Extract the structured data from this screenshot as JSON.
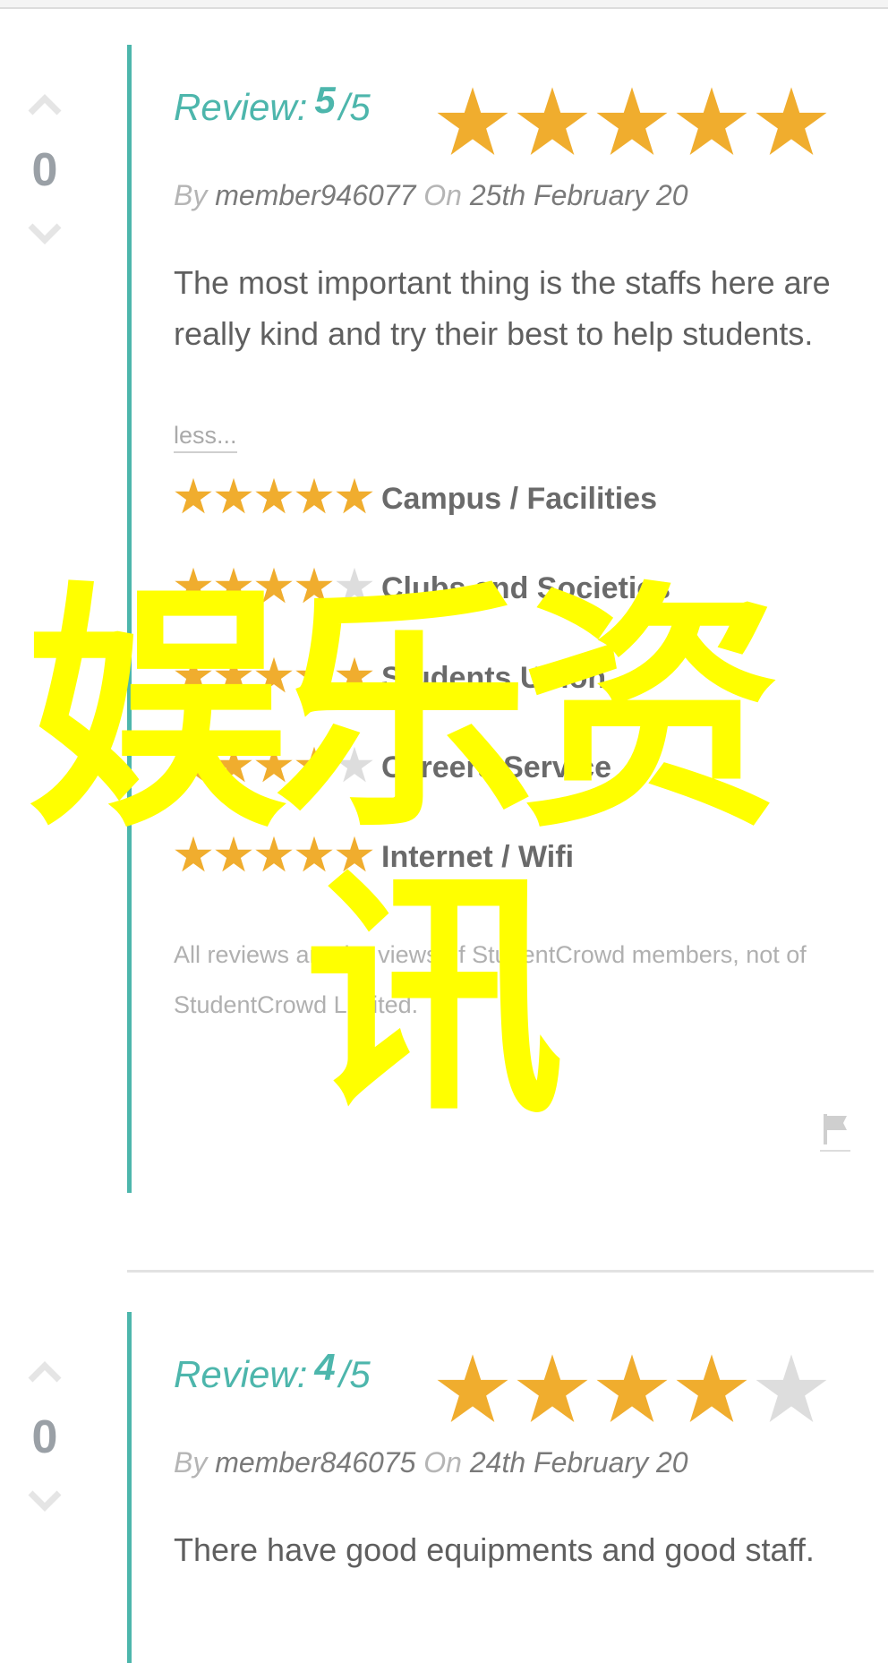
{
  "reviews": [
    {
      "votes": "0",
      "review_label": "Review:",
      "rating_value": "5",
      "rating_max": "/5",
      "rating_stars": 5,
      "by_label": "By",
      "member": "member946077",
      "on_label": "On",
      "date": "25th February 20",
      "text": "The most important thing is the staffs here are really kind and try their best to help students.",
      "less_link": "less...",
      "categories": [
        {
          "label": "Campus / Facilities",
          "stars": 5
        },
        {
          "label": "Clubs and Societies",
          "stars": 4
        },
        {
          "label": "Students Union",
          "stars": 5
        },
        {
          "label": "Careers Service",
          "stars": 4
        },
        {
          "label": "Internet / Wifi",
          "stars": 5
        }
      ],
      "disclaimer": "All reviews are the views of StudentCrowd members, not of StudentCrowd Limited."
    },
    {
      "votes": "0",
      "review_label": "Review:",
      "rating_value": "4",
      "rating_max": "/5",
      "rating_stars": 4,
      "by_label": "By",
      "member": "member846075",
      "on_label": "On",
      "date": "24th February 20",
      "text": "There have good equipments and good staff."
    }
  ],
  "watermark": {
    "line1": "娱乐资",
    "line2": "讯"
  },
  "colors": {
    "accent": "#4db6ac",
    "star_on": "#f0ad2e",
    "star_off": "#dddddd",
    "watermark": "#ffff00"
  },
  "icons": {
    "upvote": "chevron-up-icon",
    "downvote": "chevron-down-icon",
    "star": "star-icon",
    "flag": "flag-icon"
  }
}
